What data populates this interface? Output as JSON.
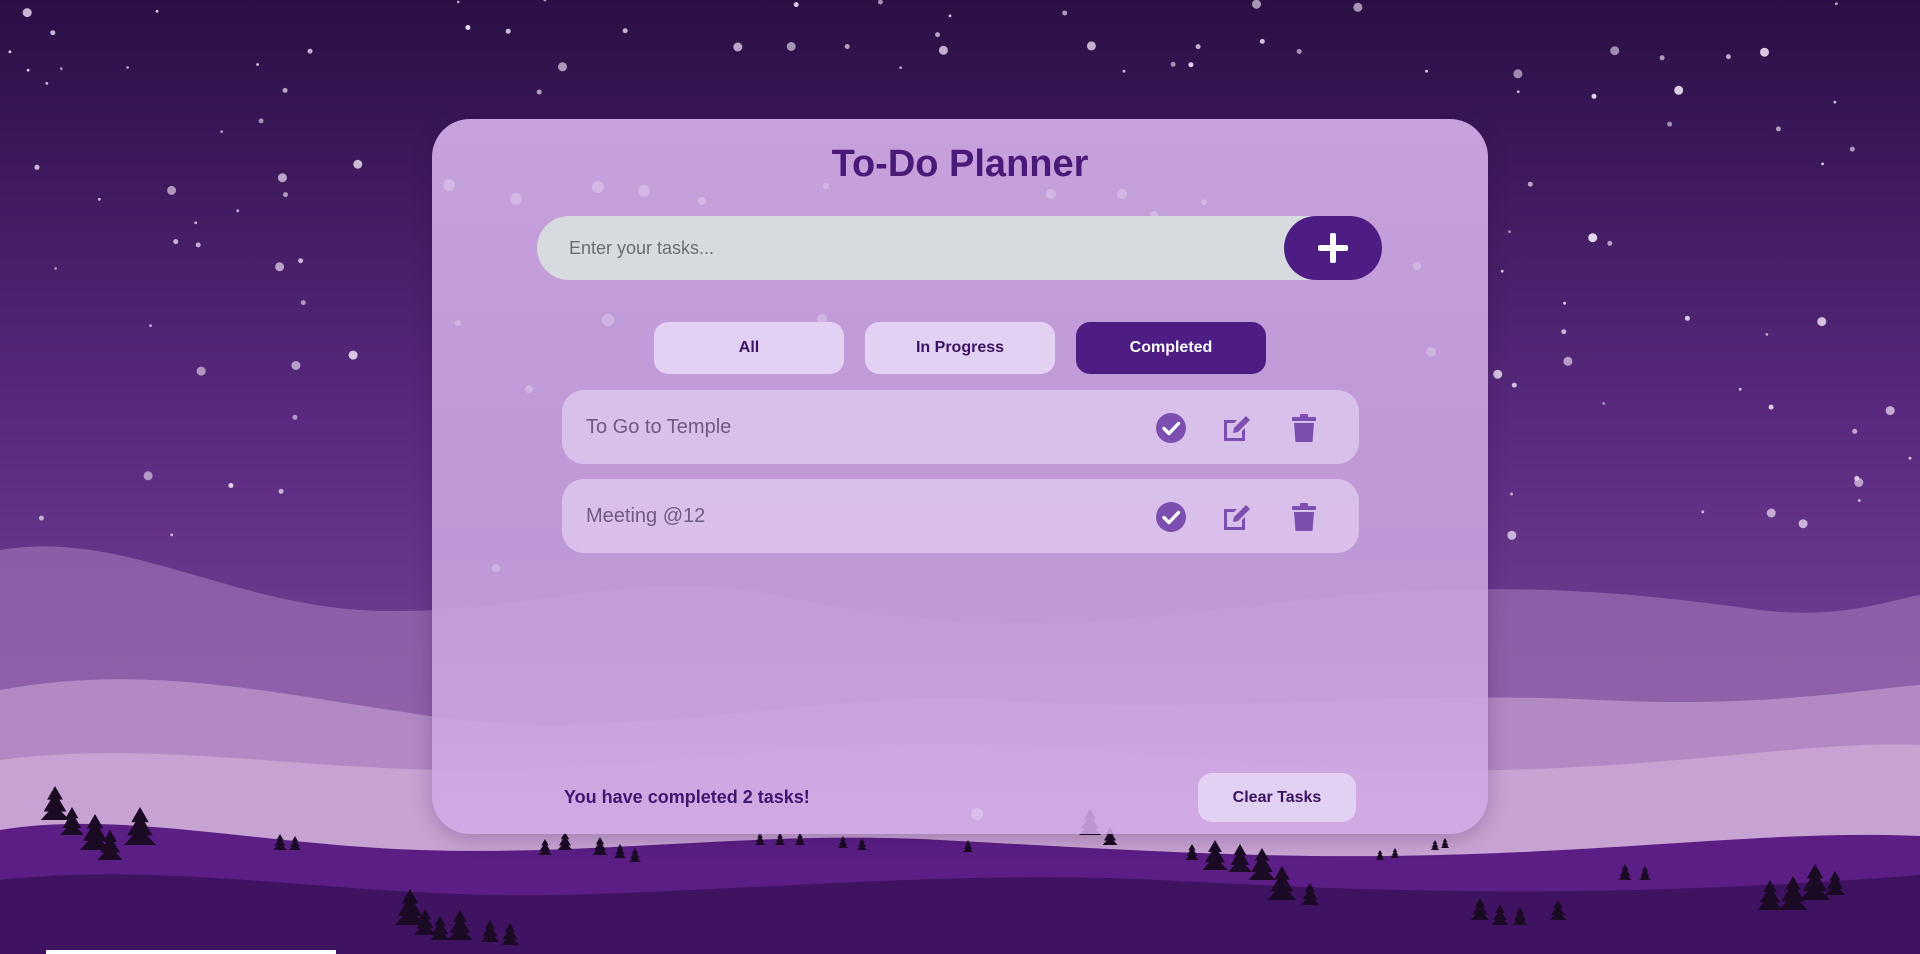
{
  "app": {
    "title": "To-Do Planner"
  },
  "input": {
    "placeholder": "Enter your tasks...",
    "value": "",
    "add_icon": "plus-icon"
  },
  "tabs": [
    {
      "label": "All",
      "active": false
    },
    {
      "label": "In Progress",
      "active": false
    },
    {
      "label": "Completed",
      "active": true
    }
  ],
  "tasks": [
    {
      "text": "To Go to Temple",
      "icons": [
        "check-circle-icon",
        "edit-icon",
        "trash-icon"
      ]
    },
    {
      "text": "Meeting @12",
      "icons": [
        "check-circle-icon",
        "edit-icon",
        "trash-icon"
      ]
    }
  ],
  "footer": {
    "status_text": "You have completed 2 tasks!",
    "clear_label": "Clear Tasks"
  },
  "colors": {
    "accent": "#4e1d84",
    "title": "#4a1a78",
    "icon": "#7b4eb0",
    "tab_inactive": "#e3d1f3"
  }
}
